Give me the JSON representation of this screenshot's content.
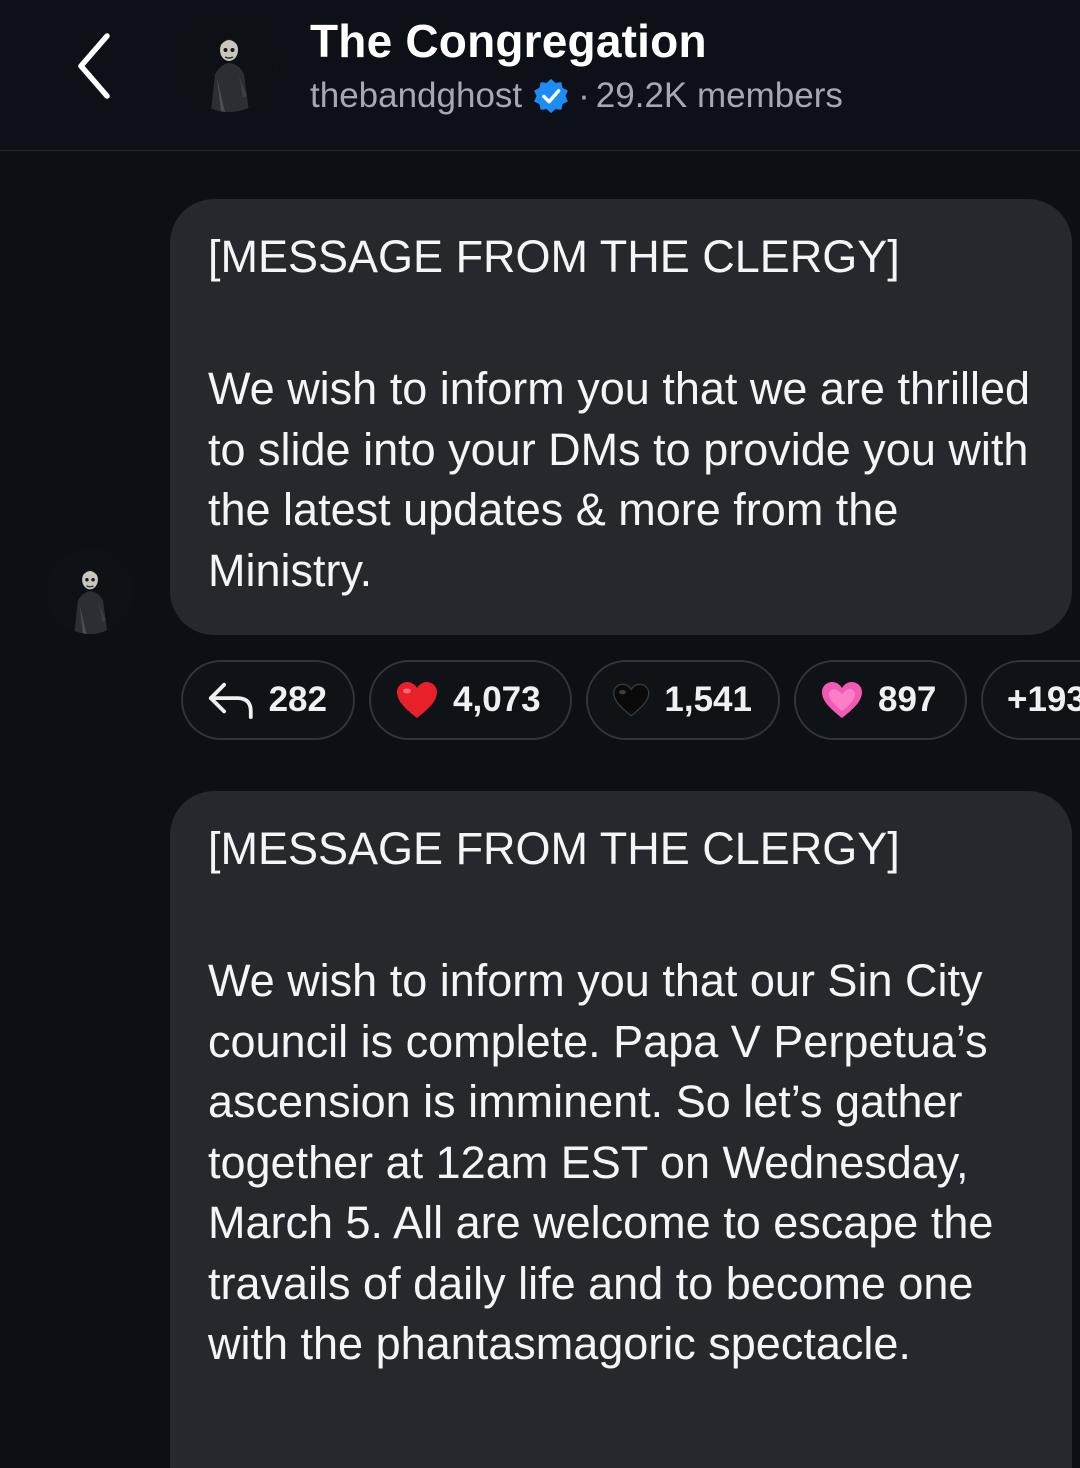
{
  "header": {
    "back_icon": "chevron-left-icon",
    "title": "The Congregation",
    "username": "thebandghost",
    "verified_icon": "verified-badge-icon",
    "separator": "·",
    "members": "29.2K members"
  },
  "colors": {
    "background": "#0c0f14",
    "bubble": "#25282d",
    "verified": "#1d8cf7",
    "text": "#f4f5f7",
    "secondary_text": "#a3a9b2"
  },
  "messages": [
    {
      "heading": "[MESSAGE FROM THE CLERGY]",
      "body": "We wish to inform you that we are thrilled to slide into your DMs to provide you with the latest updates & more from the Ministry."
    },
    {
      "heading": "[MESSAGE FROM THE CLERGY]",
      "body": "We wish to inform you that our Sin City council is complete. Papa V Perpetua’s ascension is imminent. So let’s gather together at 12am EST on Wednesday, March 5. All are welcome to escape the travails of daily life and to become one with the phantasmagoric spectacle."
    }
  ],
  "reactions": [
    {
      "icon": "reply-arrow-icon",
      "count": "282"
    },
    {
      "icon": "red-heart-icon",
      "count": "4,073"
    },
    {
      "icon": "black-heart-icon",
      "count": "1,541"
    },
    {
      "icon": "pink-heart-icon",
      "count": "897"
    },
    {
      "icon": "more-reactions",
      "count": "+193"
    }
  ]
}
